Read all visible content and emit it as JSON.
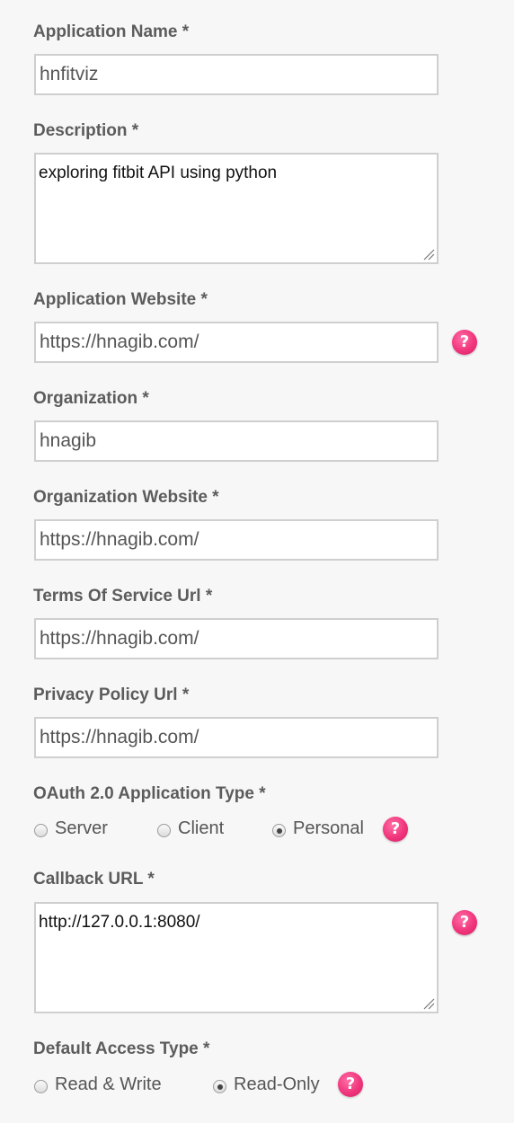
{
  "form": {
    "app_name": {
      "label": "Application Name *",
      "value": "hnfitviz"
    },
    "description": {
      "label": "Description *",
      "value": "exploring fitbit API using python"
    },
    "app_website": {
      "label": "Application Website *",
      "value": "https://hnagib.com/",
      "help": "?"
    },
    "organization": {
      "label": "Organization *",
      "value": "hnagib"
    },
    "org_website": {
      "label": "Organization Website *",
      "value": "https://hnagib.com/"
    },
    "tos_url": {
      "label": "Terms Of Service Url *",
      "value": "https://hnagib.com/"
    },
    "privacy_url": {
      "label": "Privacy Policy Url *",
      "value": "https://hnagib.com/"
    },
    "oauth_type": {
      "label": "OAuth 2.0 Application Type *",
      "options": [
        "Server",
        "Client",
        "Personal"
      ],
      "selected": "Personal",
      "help": "?"
    },
    "callback_url": {
      "label": "Callback URL *",
      "value": "http://127.0.0.1:8080/",
      "help": "?"
    },
    "access_type": {
      "label": "Default Access Type *",
      "options": [
        "Read & Write",
        "Read-Only"
      ],
      "selected": "Read-Only",
      "help": "?"
    }
  },
  "colors": {
    "help_icon": "#f0357c",
    "background": "#f7f7f7",
    "label": "#5c5c5c"
  },
  "icons": {
    "help": "question-mark-icon",
    "resize": "resize-grip-icon"
  }
}
